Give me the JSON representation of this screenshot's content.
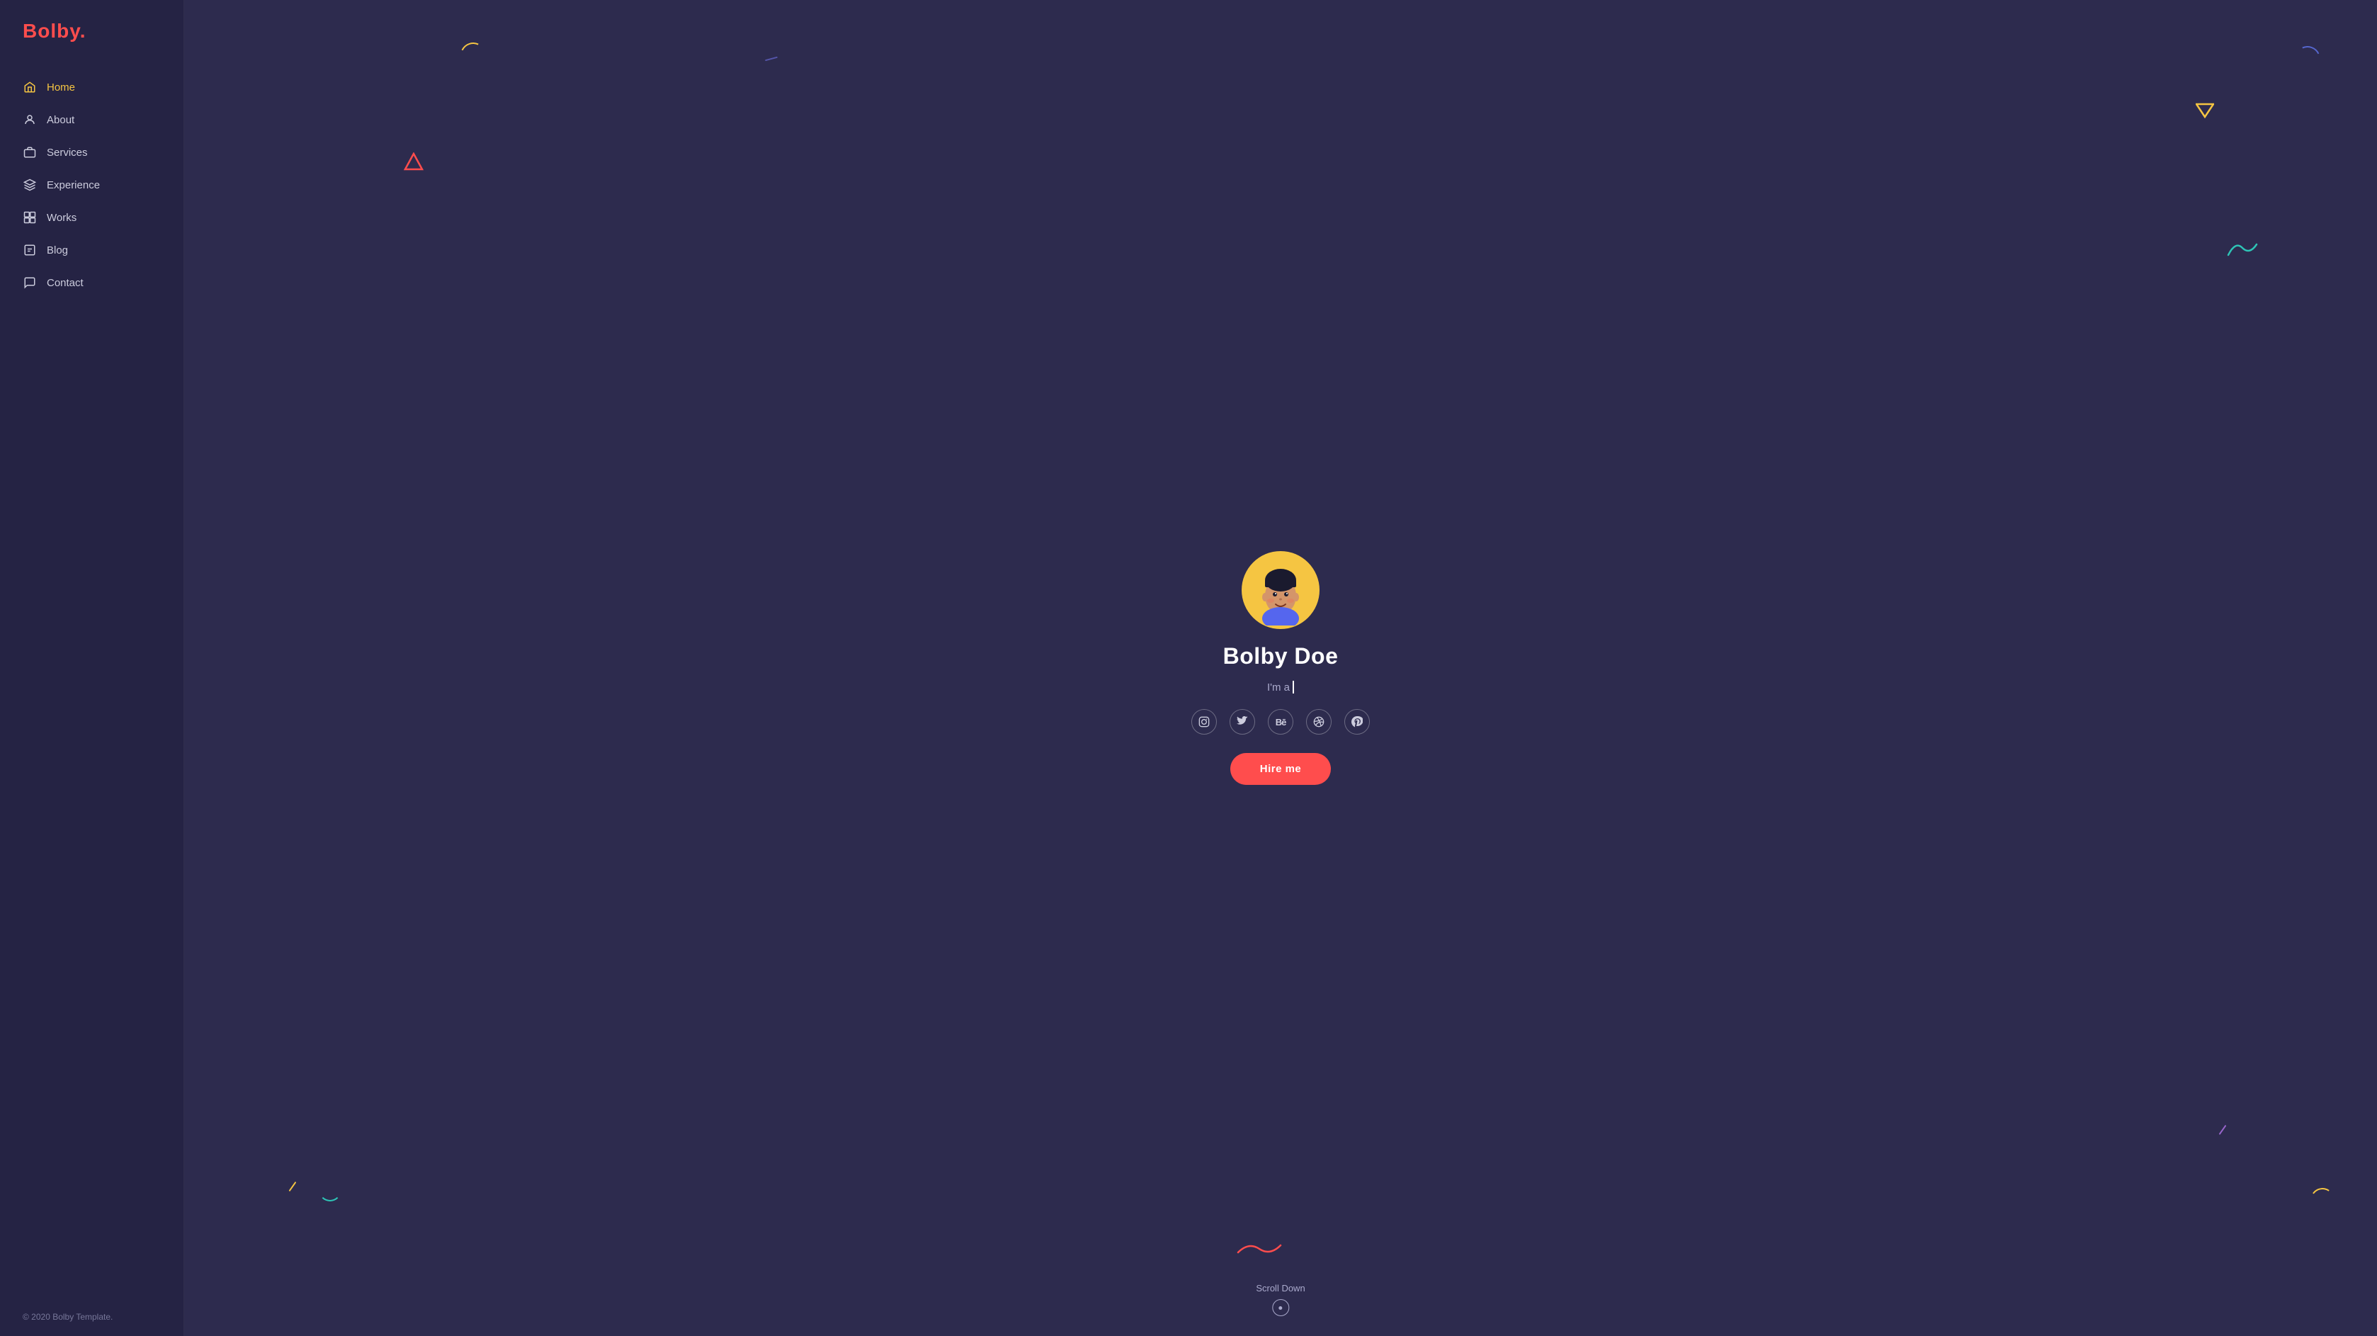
{
  "logo": {
    "text": "Bolby",
    "dot": "."
  },
  "nav": {
    "items": [
      {
        "id": "home",
        "label": "Home",
        "icon": "🏠",
        "active": true
      },
      {
        "id": "about",
        "label": "About",
        "icon": "👤",
        "active": false
      },
      {
        "id": "services",
        "label": "Services",
        "icon": "💼",
        "active": false
      },
      {
        "id": "experience",
        "label": "Experience",
        "icon": "🎓",
        "active": false
      },
      {
        "id": "works",
        "label": "Works",
        "icon": "📦",
        "active": false
      },
      {
        "id": "blog",
        "label": "Blog",
        "icon": "✏️",
        "active": false
      },
      {
        "id": "contact",
        "label": "Contact",
        "icon": "💬",
        "active": false
      }
    ]
  },
  "footer": {
    "copyright": "© 2020 Bolby Template."
  },
  "hero": {
    "name": "Bolby Doe",
    "subtitle": "I'm a ",
    "hire_label": "Hire me"
  },
  "scroll": {
    "label": "Scroll Down"
  },
  "social": [
    {
      "id": "instagram",
      "symbol": "◯"
    },
    {
      "id": "twitter",
      "symbol": "𝕏"
    },
    {
      "id": "behance",
      "symbol": "Bē"
    },
    {
      "id": "dribbble",
      "symbol": "⊕"
    },
    {
      "id": "pinterest",
      "symbol": "𝑃"
    }
  ]
}
